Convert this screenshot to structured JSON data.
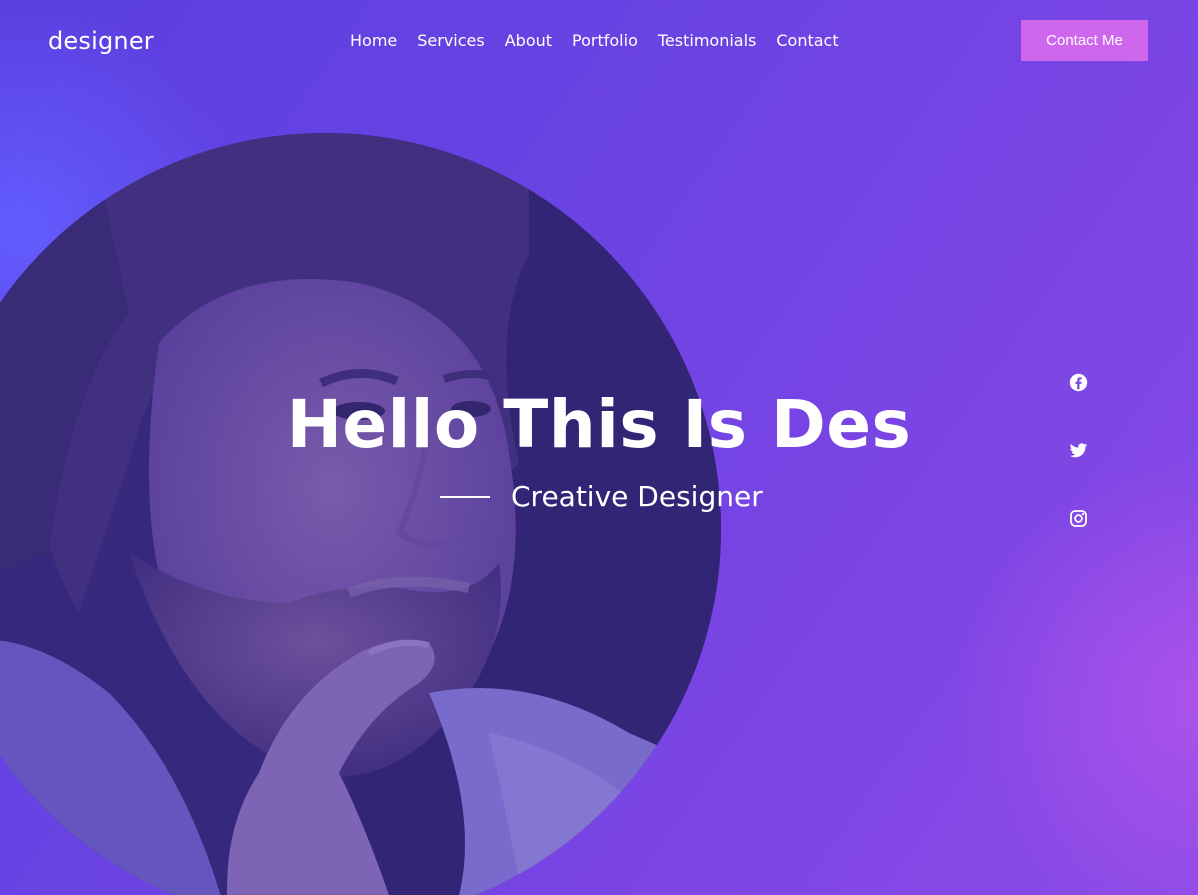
{
  "header": {
    "logo": "designer",
    "nav": [
      "Home",
      "Services",
      "About",
      "Portfolio",
      "Testimonials",
      "Contact"
    ],
    "cta_label": "Contact Me"
  },
  "hero": {
    "title": "Hello This Is Des",
    "subtitle": "Creative Designer"
  },
  "social": [
    "facebook-icon",
    "twitter-icon",
    "instagram-icon"
  ],
  "colors": {
    "background_start": "#5a3fe0",
    "background_end": "#8c4be6",
    "cta_button": "#cf67ee",
    "text": "#ffffff"
  }
}
